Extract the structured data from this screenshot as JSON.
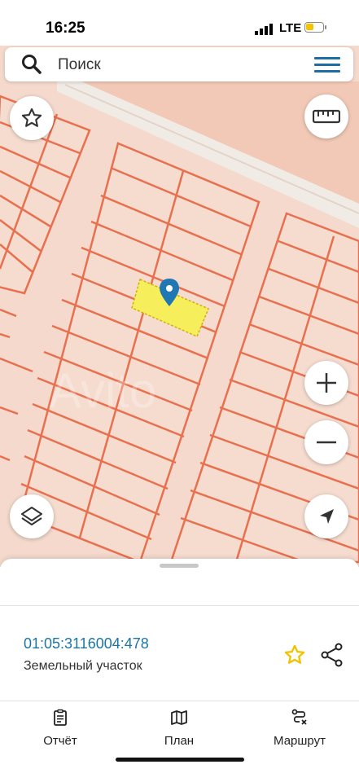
{
  "status": {
    "time": "16:25",
    "network": "LTE"
  },
  "search": {
    "placeholder": "Поиск"
  },
  "map": {
    "selected_parcel_color": "#f7ee5c",
    "boundary_color": "#e8704f",
    "pin_color": "#1f78b4",
    "watermark": "Avito"
  },
  "parcel": {
    "cadastral_number": "01:05:3116004:478",
    "type": "Земельный участок"
  },
  "tabs": [
    {
      "label": "Отчёт",
      "icon": "report-icon"
    },
    {
      "label": "План",
      "icon": "map-icon"
    },
    {
      "label": "Маршрут",
      "icon": "route-icon"
    }
  ],
  "accent_color": "#1b76a6",
  "favorite_color": "#f2c200"
}
